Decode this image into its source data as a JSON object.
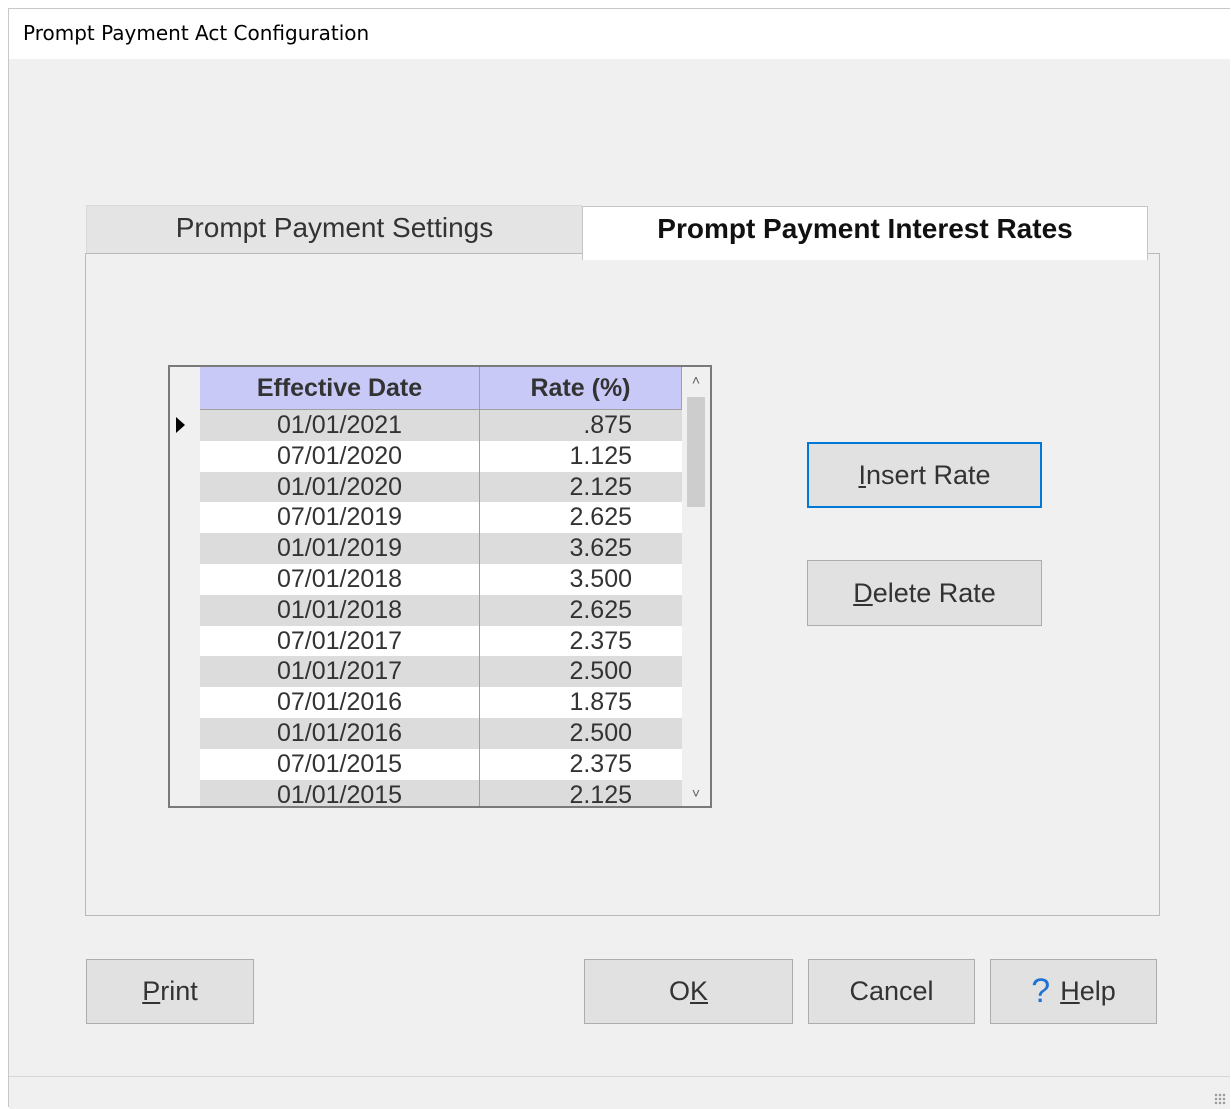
{
  "window": {
    "title": "Prompt Payment Act Configuration"
  },
  "tabs": [
    {
      "label": "Prompt Payment Settings",
      "active": false
    },
    {
      "label": "Prompt Payment Interest Rates",
      "active": true
    }
  ],
  "grid": {
    "columns": [
      "Effective Date",
      "Rate (%)"
    ],
    "selected_row": 0,
    "rows": [
      {
        "date": "01/01/2021",
        "rate": ".875"
      },
      {
        "date": "07/01/2020",
        "rate": "1.125"
      },
      {
        "date": "01/01/2020",
        "rate": "2.125"
      },
      {
        "date": "07/01/2019",
        "rate": "2.625"
      },
      {
        "date": "01/01/2019",
        "rate": "3.625"
      },
      {
        "date": "07/01/2018",
        "rate": "3.500"
      },
      {
        "date": "01/01/2018",
        "rate": "2.625"
      },
      {
        "date": "07/01/2017",
        "rate": "2.375"
      },
      {
        "date": "01/01/2017",
        "rate": "2.500"
      },
      {
        "date": "07/01/2016",
        "rate": "1.875"
      },
      {
        "date": "01/01/2016",
        "rate": "2.500"
      },
      {
        "date": "07/01/2015",
        "rate": "2.375"
      },
      {
        "date": "01/01/2015",
        "rate": "2.125"
      }
    ]
  },
  "buttons": {
    "insert_rate": {
      "mnemonic": "I",
      "rest": "nsert Rate"
    },
    "delete_rate": {
      "mnemonic": "D",
      "rest": "elete Rate"
    },
    "print": {
      "mnemonic": "P",
      "rest": "rint"
    },
    "ok": {
      "pre": "O",
      "mnemonic": "K"
    },
    "cancel": "Cancel",
    "help": {
      "icon": "?",
      "mnemonic": "H",
      "rest": "elp"
    }
  },
  "colors": {
    "header_bg": "#c9c9f7",
    "focus_border": "#0078d7",
    "help_icon": "#1e72d6"
  }
}
